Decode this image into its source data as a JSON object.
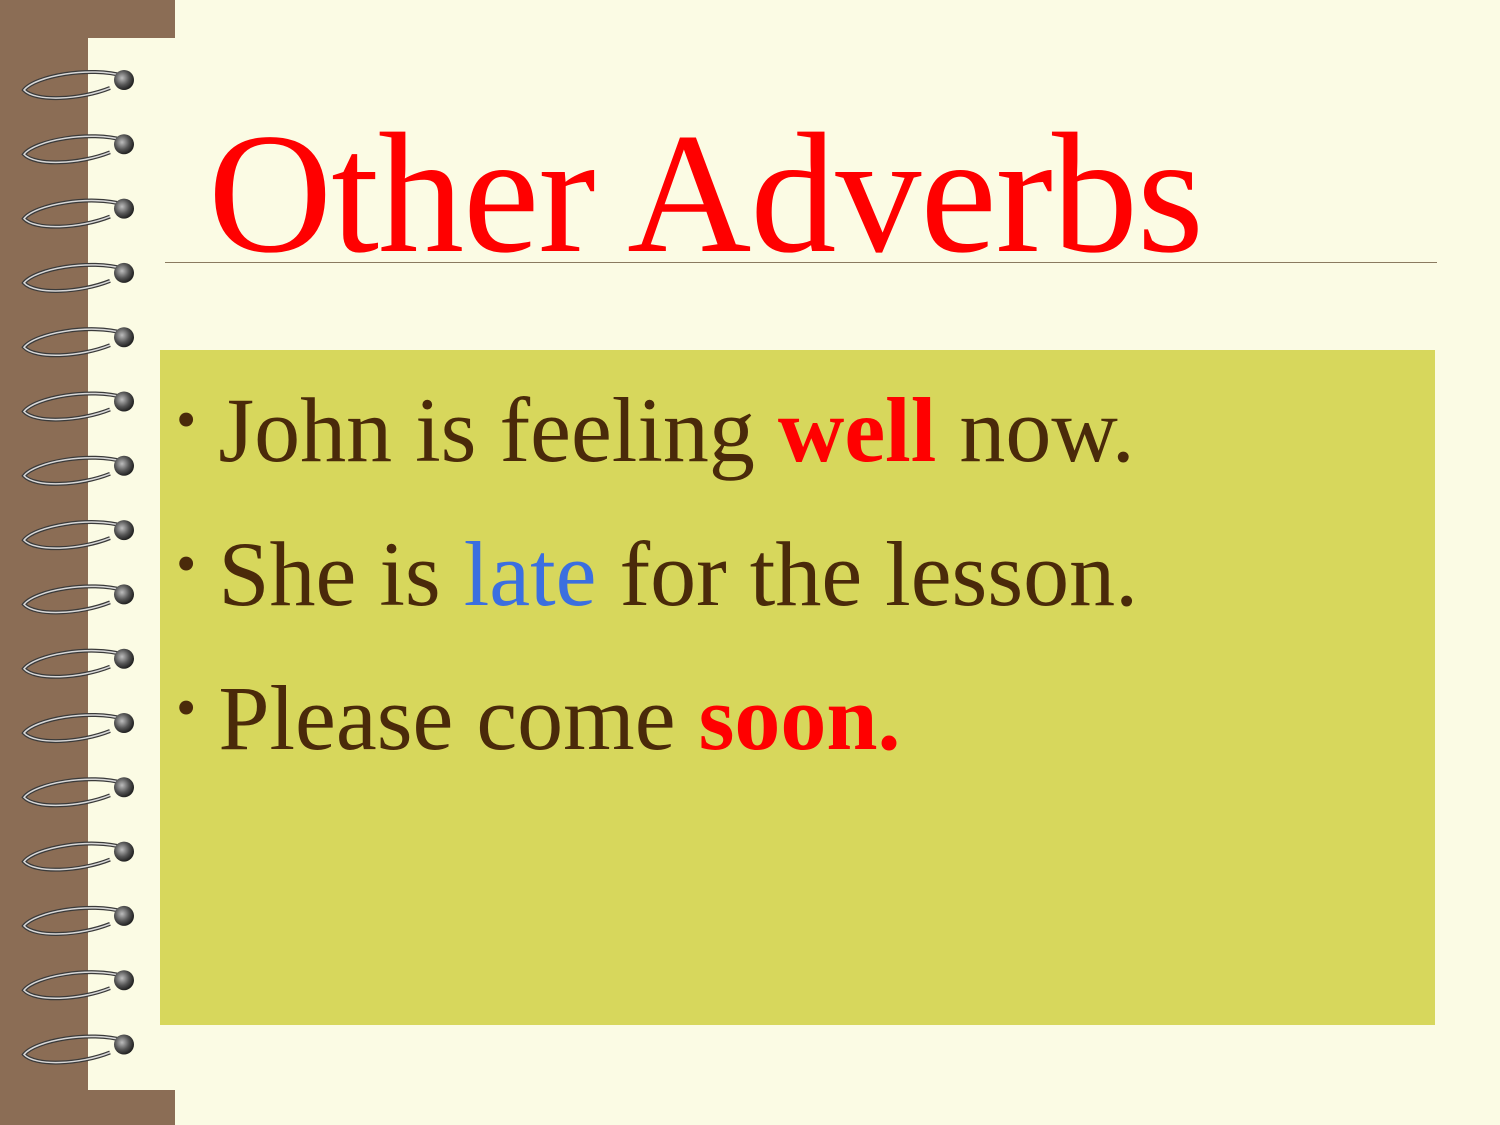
{
  "slide": {
    "title": "Other Adverbs",
    "bullet_symbol": "•",
    "bullets": [
      {
        "pre": "John is feeling ",
        "highlight": "well",
        "post": " now.",
        "highlight_style": "bold-red"
      },
      {
        "pre": "She is ",
        "highlight": "late",
        "post": " for the lesson.",
        "highlight_style": "blue"
      },
      {
        "pre": "Please come ",
        "highlight": "soon.",
        "post": "",
        "highlight_style": "bold-red"
      }
    ]
  },
  "colors": {
    "background": "#fbfbe4",
    "spine": "#8b6d55",
    "panel": "#d7d75c",
    "title": "#ff0000",
    "body_text": "#4a2a0a",
    "highlight_red": "#ff0000",
    "highlight_blue": "#3b6fe0"
  },
  "icons": {
    "binding": "spiral-binding-icon"
  }
}
